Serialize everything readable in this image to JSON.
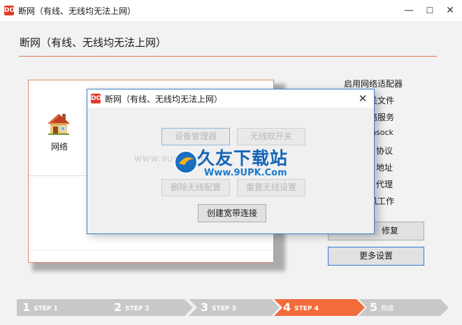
{
  "window": {
    "logo_text": "DO",
    "title": "断网（有线、无线均无法上网）",
    "minimize_glyph": "—",
    "maximize_glyph": "☐",
    "close_glyph": "✕"
  },
  "main": {
    "heading": "断网（有线、无线均无法上网）",
    "network_label": "网络",
    "network_icon": "house-icon"
  },
  "right_list": {
    "items": [
      "启用网络适配器",
      "关文件",
      "络服务",
      "insock",
      "协议",
      "地址",
      "代理",
      "机工作"
    ],
    "repair_button": "修复",
    "more_button": "更多设置"
  },
  "steps": [
    {
      "num": "1",
      "label": "STEP 1",
      "state": "done"
    },
    {
      "num": "2",
      "label": "STEP 2",
      "state": "done"
    },
    {
      "num": "3",
      "label": "STEP 3",
      "state": "done"
    },
    {
      "num": "4",
      "label": "STEP 4",
      "state": "active"
    },
    {
      "num": "5",
      "label": "完成",
      "state": "pending"
    }
  ],
  "dialog": {
    "logo_text": "DO",
    "title": "断网（有线、无线均无法上网）",
    "close_glyph": "✕",
    "buttons": {
      "device_manager": "设备管理器",
      "wifi_switch": "无线软开关",
      "delete_wifi": "删除无线配置",
      "reset": "重置无线设置",
      "create_broadband": "创建宽带连接"
    }
  },
  "watermark": {
    "title": "久友下载站",
    "url": "Www.9UPK.Com",
    "small": "WWW.9UPK.COM"
  },
  "colors": {
    "accent": "#e2754f",
    "active_step": "#f26b3a",
    "step_gray": "#c8c8c8",
    "dialog_border": "#3c7fd1",
    "logo_red": "#e23a2a",
    "watermark_blue": "#1565b8"
  }
}
